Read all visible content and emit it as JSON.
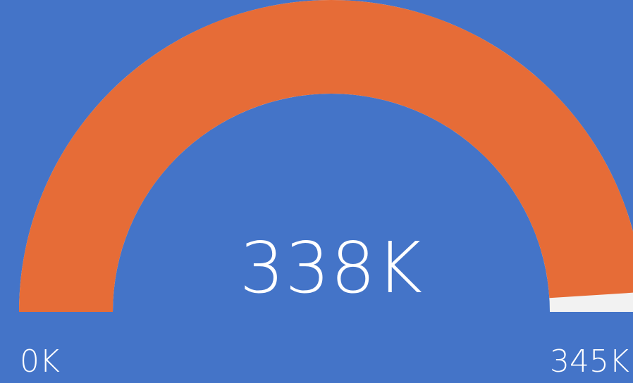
{
  "chart_data": {
    "type": "gauge",
    "value": 338,
    "min": 0,
    "max": 345,
    "value_label": "338K",
    "min_label": "0K",
    "max_label": "345K"
  },
  "colors": {
    "background": "#4474C8",
    "fill": "#E66C37",
    "track": "#F2F2F2",
    "text": "#FFFFFF"
  }
}
